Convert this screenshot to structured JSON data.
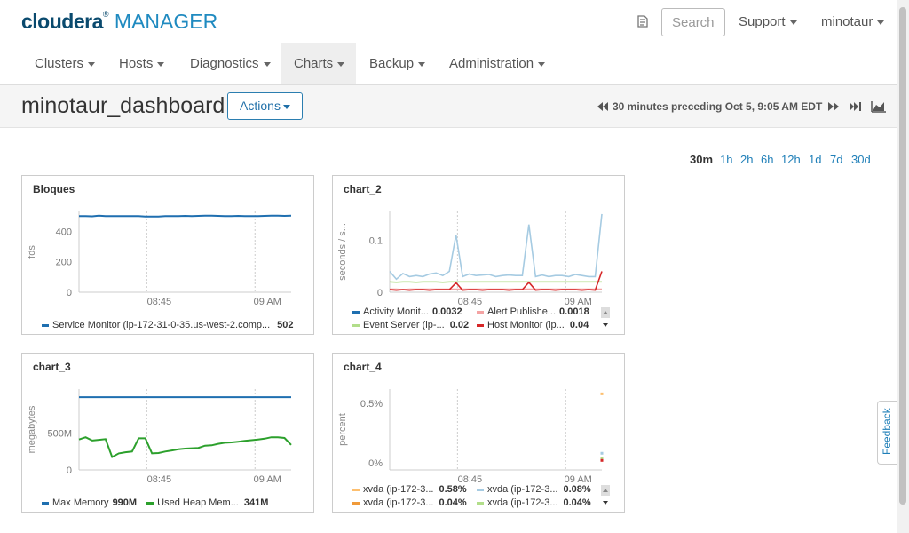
{
  "header": {
    "logo_a": "cloudera",
    "logo_b": "MANAGER",
    "search_placeholder": "Search",
    "support": "Support",
    "user": "minotaur"
  },
  "nav": [
    "Clusters",
    "Hosts",
    "Diagnostics",
    "Charts",
    "Backup",
    "Administration"
  ],
  "page": {
    "title": "minotaur_dashboard",
    "actions": "Actions",
    "time_label": "30 minutes preceding Oct 5, 9:05 AM EDT"
  },
  "ranges": [
    "30m",
    "1h",
    "2h",
    "6h",
    "12h",
    "1d",
    "7d",
    "30d"
  ],
  "feedback": "Feedback",
  "colors": {
    "blue": "#1f6fb0",
    "green": "#2ca02c",
    "lightblue": "#a6cbe2",
    "pink": "#f4a3a3",
    "lightgreen": "#b2de8a",
    "red": "#d62728",
    "orange": "#f09a3a",
    "peach": "#fdbf6f"
  },
  "chart_data": [
    {
      "type": "line",
      "title": "Bloques",
      "ylabel": "fds",
      "xticks": [
        "08:45",
        "09 AM"
      ],
      "yticks": [
        "0",
        "200",
        "400"
      ],
      "ylim": [
        0,
        530
      ],
      "series": [
        {
          "name": "Service Monitor (ip-172-31-0-35.us-west-2.comp...",
          "last": "502",
          "color": "#1f6fb0",
          "values": [
            500,
            500,
            498,
            502,
            499,
            500,
            500,
            499,
            500,
            500,
            497,
            496,
            497,
            499,
            500,
            500,
            501,
            500,
            501,
            502,
            502,
            501,
            499,
            500,
            501,
            500,
            499,
            500,
            501,
            502,
            502,
            501,
            502
          ]
        }
      ]
    },
    {
      "type": "line",
      "title": "chart_2",
      "ylabel": "seconds / s...",
      "xticks": [
        "08:45",
        "09 AM"
      ],
      "yticks": [
        "0",
        "0.1"
      ],
      "ylim": [
        0,
        0.155
      ],
      "series": [
        {
          "name": "Activity Monit...",
          "last": "0.0032",
          "color": "#a6cbe2",
          "values": [
            0.04,
            0.025,
            0.036,
            0.03,
            0.032,
            0.03,
            0.035,
            0.037,
            0.032,
            0.04,
            0.11,
            0.03,
            0.035,
            0.032,
            0.033,
            0.034,
            0.03,
            0.032,
            0.033,
            0.032,
            0.032,
            0.13,
            0.03,
            0.033,
            0.03,
            0.032,
            0.032,
            0.03,
            0.034,
            0.032,
            0.03,
            0.03,
            0.15
          ]
        },
        {
          "name": "Alert Publishe...",
          "last": "0.0018",
          "color": "#f4a3a3",
          "values": [
            0.006,
            0.006,
            0.005,
            0.006,
            0.006,
            0.006,
            0.006,
            0.006,
            0.006,
            0.006,
            0.006,
            0.006,
            0.006,
            0.006,
            0.006,
            0.006,
            0.006,
            0.006,
            0.006,
            0.006,
            0.006,
            0.006,
            0.006,
            0.006,
            0.006,
            0.006,
            0.006,
            0.006,
            0.006,
            0.006,
            0.006,
            0.006,
            0.006
          ]
        },
        {
          "name": "Event Server (ip-...",
          "last": "0.02",
          "color": "#b2de8a",
          "values": [
            0.02,
            0.019,
            0.02,
            0.02,
            0.019,
            0.02,
            0.02,
            0.02,
            0.019,
            0.02,
            0.02,
            0.02,
            0.02,
            0.02,
            0.02,
            0.02,
            0.02,
            0.02,
            0.02,
            0.02,
            0.02,
            0.02,
            0.02,
            0.02,
            0.02,
            0.02,
            0.02,
            0.02,
            0.02,
            0.02,
            0.02,
            0.02,
            0.02
          ]
        },
        {
          "name": "Host Monitor (ip...",
          "last": "0.04",
          "color": "#d62728",
          "values": [
            0.005,
            0.004,
            0.005,
            0.004,
            0.005,
            0.005,
            0.004,
            0.005,
            0.005,
            0.005,
            0.018,
            0.004,
            0.005,
            0.005,
            0.004,
            0.005,
            0.005,
            0.005,
            0.004,
            0.005,
            0.005,
            0.019,
            0.004,
            0.005,
            0.005,
            0.004,
            0.005,
            0.005,
            0.005,
            0.004,
            0.005,
            0.004,
            0.04
          ]
        }
      ]
    },
    {
      "type": "line",
      "title": "chart_3",
      "ylabel": "megabytes",
      "xticks": [
        "08:45",
        "09 AM"
      ],
      "yticks": [
        "0",
        "500M"
      ],
      "ylim": [
        0,
        1100
      ],
      "series": [
        {
          "name": "Max Memory",
          "last": "990M",
          "color": "#1f6fb0",
          "values": [
            990,
            990,
            990,
            990,
            990,
            990,
            990,
            990,
            990,
            990,
            990,
            990,
            990,
            990,
            990,
            990,
            990,
            990,
            990,
            990,
            990,
            990,
            990,
            990,
            990,
            990,
            990,
            990,
            990,
            990,
            990,
            990,
            990
          ]
        },
        {
          "name": "Used Heap Mem...",
          "last": "341M",
          "color": "#2ca02c",
          "values": [
            415,
            445,
            400,
            410,
            420,
            175,
            225,
            240,
            250,
            430,
            430,
            225,
            230,
            250,
            265,
            280,
            290,
            295,
            300,
            330,
            335,
            355,
            370,
            375,
            385,
            395,
            405,
            415,
            425,
            445,
            445,
            435,
            341
          ]
        }
      ]
    },
    {
      "type": "scatter",
      "title": "chart_4",
      "ylabel": "percent",
      "xticks": [
        "08:45",
        "09 AM"
      ],
      "yticks": [
        "0%",
        "0.5%"
      ],
      "ylim": [
        -0.06,
        0.62
      ],
      "series": [
        {
          "name": "xvda (ip-172-3...",
          "last": "0.58%",
          "color": "#fdbf6f",
          "points": [
            [
              32,
              0.58
            ]
          ]
        },
        {
          "name": "xvda (ip-172-3...",
          "last": "0.08%",
          "color": "#a6cbe2",
          "points": [
            [
              32,
              0.08
            ]
          ]
        },
        {
          "name": "xvda (ip-172-3...",
          "last": "0.04%",
          "color": "#f09a3a",
          "points": [
            [
              32,
              0.04
            ]
          ]
        },
        {
          "name": "xvda (ip-172-3...",
          "last": "0.04%",
          "color": "#b2de8a",
          "points": [
            [
              32,
              0.035
            ]
          ]
        },
        {
          "name": "",
          "last": "",
          "color": "#d62728",
          "points": [
            [
              32,
              0.02
            ]
          ]
        }
      ]
    }
  ]
}
